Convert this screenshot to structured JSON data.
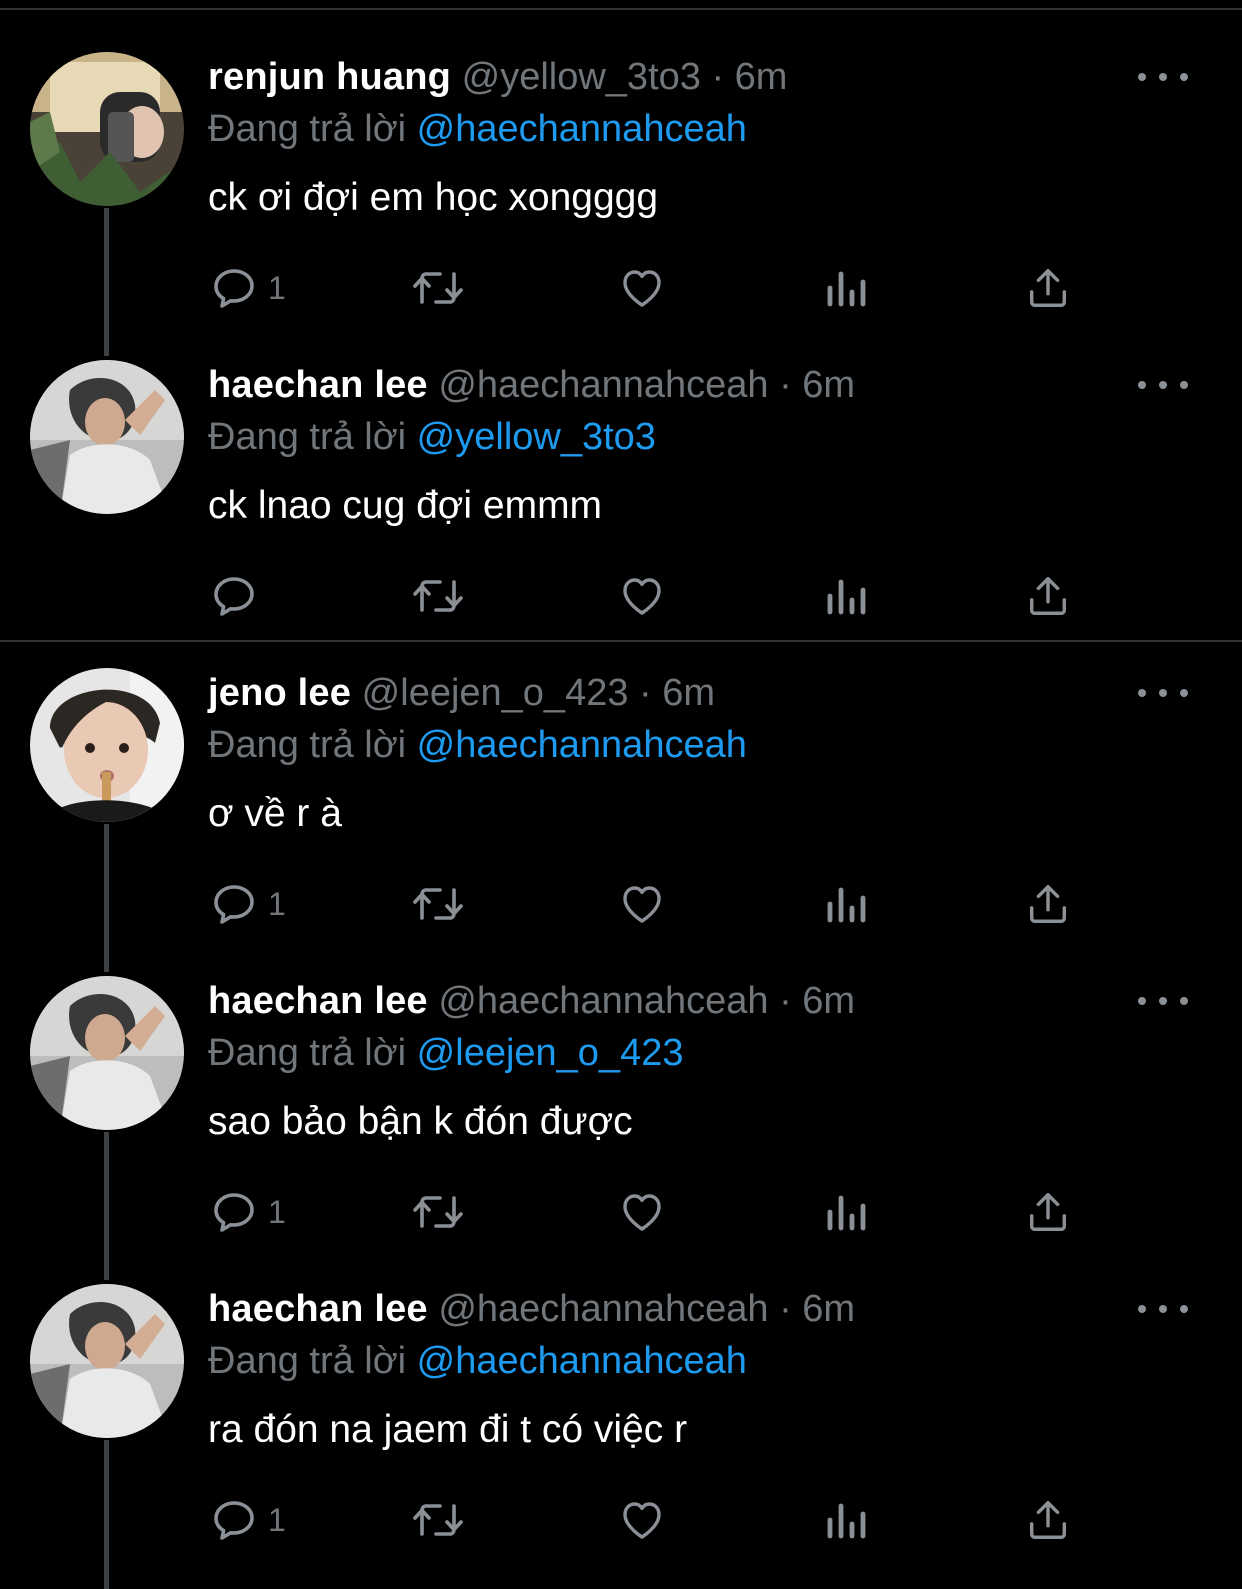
{
  "colors": {
    "background": "#000000",
    "name": "#ffffff",
    "secondary_text": "#71767b",
    "mention": "#1d9bf0",
    "divider": "#2f3336",
    "icon": "#8b9096"
  },
  "tweets": [
    {
      "name": "renjun huang",
      "handle": "@yellow_3to3",
      "dot": "·",
      "time": "6m",
      "reply_prefix": "Đang trả lời",
      "reply_to": "@haechannahceah",
      "text": "ck ơi đợi em học xongggg",
      "reply_count": "1",
      "avatar_icon": "avatar-mirror-selfie"
    },
    {
      "name": "haechan lee",
      "handle": "@haechannahceah",
      "dot": "·",
      "time": "6m",
      "reply_prefix": "Đang trả lời",
      "reply_to": "@yellow_3to3",
      "text": "ck lnao cug đợi emmm",
      "reply_count": "",
      "avatar_icon": "avatar-resting-head"
    },
    {
      "name": "jeno lee",
      "handle": "@leejen_o_423",
      "dot": "·",
      "time": "6m",
      "reply_prefix": "Đang trả lời",
      "reply_to": "@haechannahceah",
      "text": "ơ về r à",
      "reply_count": "1",
      "avatar_icon": "avatar-selfie-stick"
    },
    {
      "name": "haechan lee",
      "handle": "@haechannahceah",
      "dot": "·",
      "time": "6m",
      "reply_prefix": "Đang trả lời",
      "reply_to": "@leejen_o_423",
      "text": "sao bảo bận k đón được",
      "reply_count": "1",
      "avatar_icon": "avatar-resting-head"
    },
    {
      "name": "haechan lee",
      "handle": "@haechannahceah",
      "dot": "·",
      "time": "6m",
      "reply_prefix": "Đang trả lời",
      "reply_to": "@haechannahceah",
      "text": "ra đón na jaem đi t có việc r",
      "reply_count": "1",
      "avatar_icon": "avatar-resting-head"
    }
  ],
  "icons": {
    "reply": "reply-icon",
    "retweet": "retweet-icon",
    "like": "heart-icon",
    "views": "views-icon",
    "share": "share-icon",
    "more": "more-icon"
  }
}
